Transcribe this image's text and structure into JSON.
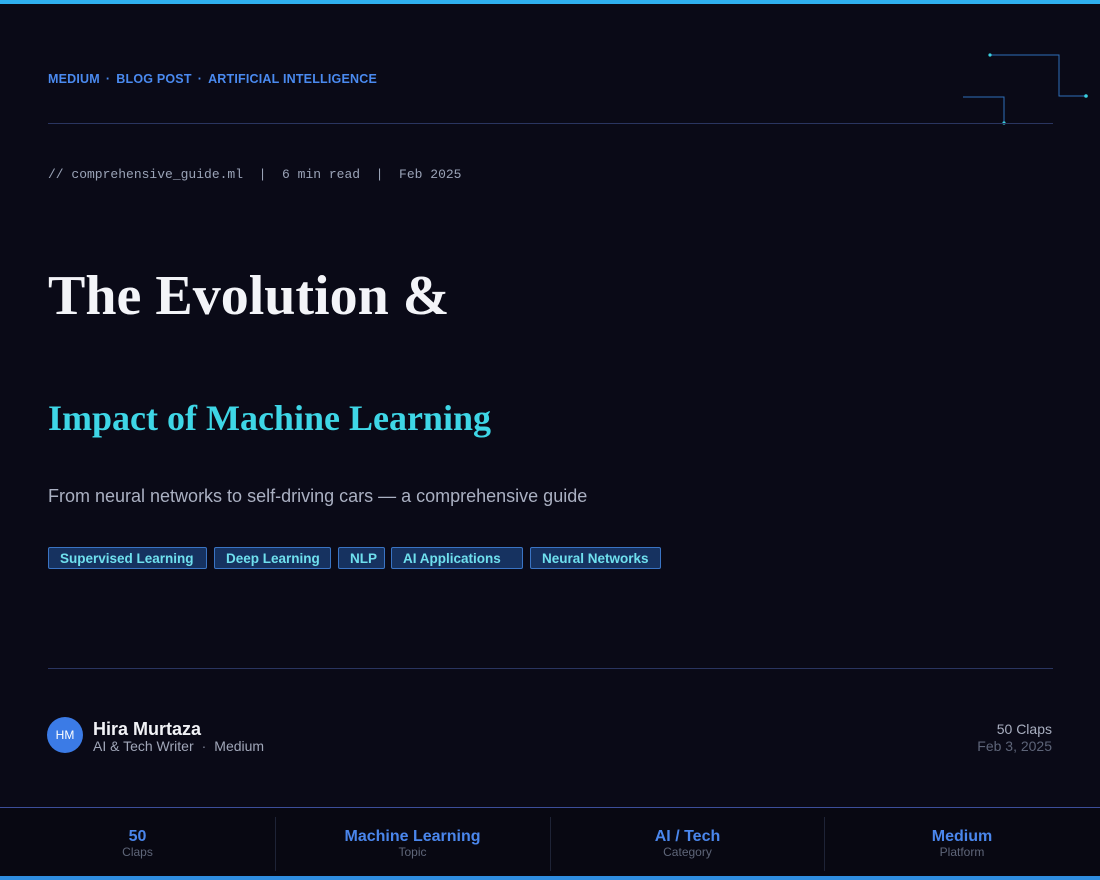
{
  "breadcrumb": [
    "MEDIUM",
    "BLOG POST",
    "ARTIFICIAL INTELLIGENCE"
  ],
  "breadcrumb_separator": "·",
  "meta_line": "// comprehensive_guide.ml  |  6 min read  |  Feb 2025",
  "title_line1": "The Evolution &",
  "title_line2": "Impact of Machine Learning",
  "subtitle": "From neural networks to self-driving cars — a comprehensive guide",
  "tags": [
    "Supervised Learning",
    "Deep Learning",
    "NLP",
    "AI Applications",
    "Neural Networks"
  ],
  "author": {
    "initials": "HM",
    "name": "Hira Murtaza",
    "role": "AI & Tech Writer",
    "separator": "·",
    "publication": "Medium"
  },
  "post_stats": {
    "claps": "50 Claps",
    "date": "Feb 3, 2025"
  },
  "stats_bar": [
    {
      "value": "50",
      "label": "Claps"
    },
    {
      "value": "Machine Learning",
      "label": "Topic"
    },
    {
      "value": "AI / Tech",
      "label": "Category"
    },
    {
      "value": "Medium",
      "label": "Platform"
    }
  ],
  "colors": {
    "background": "#0a0a17",
    "accent_blue": "#4a86ec",
    "accent_cyan": "#3ed6e6",
    "top_bar": "#2fb0f0"
  }
}
